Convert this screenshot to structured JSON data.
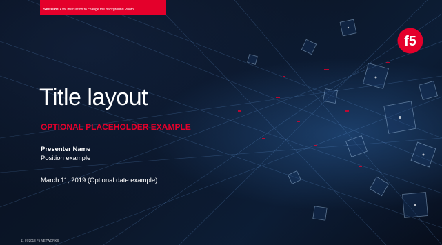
{
  "slide": {
    "note": {
      "bold": "See slide 7",
      "rest": " for instruction to change the background Photo"
    },
    "title": "Title layout",
    "subtitle": "OPTIONAL PLACEHOLDER EXAMPLE",
    "presenter_name": "Presenter Name",
    "position": "Position example",
    "date": "March 11, 2019 (Optional date example)",
    "footer": "11 | ©2018 F5 NETWORKS",
    "logo_text": "f5"
  },
  "colors": {
    "accent": "#e4002b",
    "background": "#0b1628",
    "text": "#ffffff"
  }
}
